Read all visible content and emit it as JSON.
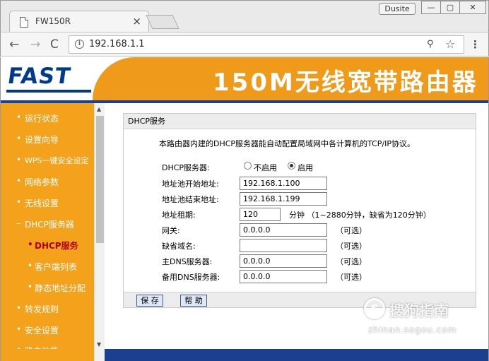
{
  "browser": {
    "tab_title": "FW150R",
    "tab_close": "×",
    "user_badge": "Dusite",
    "window_min": "—",
    "window_max": "▢",
    "window_close": "✕",
    "url": "192.168.1.1",
    "back": "←",
    "forward": "→",
    "reload": "C",
    "key_icon": "⚲",
    "star_icon": "☆",
    "menu_icon": "⋮",
    "info_icon": "i"
  },
  "header": {
    "logo": "FAST",
    "banner_title": "150M无线宽带路由器",
    "accent_color": "#f09a1c",
    "brand_color": "#003a8c"
  },
  "sidebar": {
    "items": [
      {
        "label": "运行状态",
        "bullet": "•"
      },
      {
        "label": "设置向导",
        "bullet": "•"
      },
      {
        "label": "WPS一键安全设定",
        "bullet": "•"
      },
      {
        "label": "网络参数",
        "bullet": "•"
      },
      {
        "label": "无线设置",
        "bullet": "•"
      },
      {
        "label": "DHCP服务器",
        "bullet": "–"
      },
      {
        "label": "DHCP服务",
        "bullet": "•"
      },
      {
        "label": "客户端列表",
        "bullet": "•"
      },
      {
        "label": "静态地址分配",
        "bullet": "•"
      },
      {
        "label": "转发规则",
        "bullet": "•"
      },
      {
        "label": "安全设置",
        "bullet": "•"
      },
      {
        "label": "路由功能",
        "bullet": "•"
      }
    ]
  },
  "panel": {
    "title": "DHCP服务",
    "description": "本路由器内建的DHCP服务器能自动配置局域网中各计算机的TCP/IP协议。",
    "dhcp_server_label": "DHCP服务器:",
    "disable_label": "不启用",
    "enable_label": "启用",
    "start_label": "地址池开始地址:",
    "start_value": "192.168.1.100",
    "end_label": "地址池结束地址:",
    "end_value": "192.168.1.199",
    "lease_label": "地址租期:",
    "lease_value": "120",
    "lease_note": "分钟 （1~2880分钟，缺省为120分钟）",
    "gateway_label": "网关:",
    "gateway_value": "0.0.0.0",
    "domain_label": "缺省域名:",
    "domain_value": "",
    "dns1_label": "主DNS服务器:",
    "dns1_value": "0.0.0.0",
    "dns2_label": "备用DNS服务器:",
    "dns2_value": "0.0.0.0",
    "optional": "（可选）",
    "save_label": "保 存",
    "help_label": "帮 助"
  },
  "watermark": {
    "logo": "S",
    "text": "搜狗指南",
    "url": "zhinan.sogou.com"
  }
}
